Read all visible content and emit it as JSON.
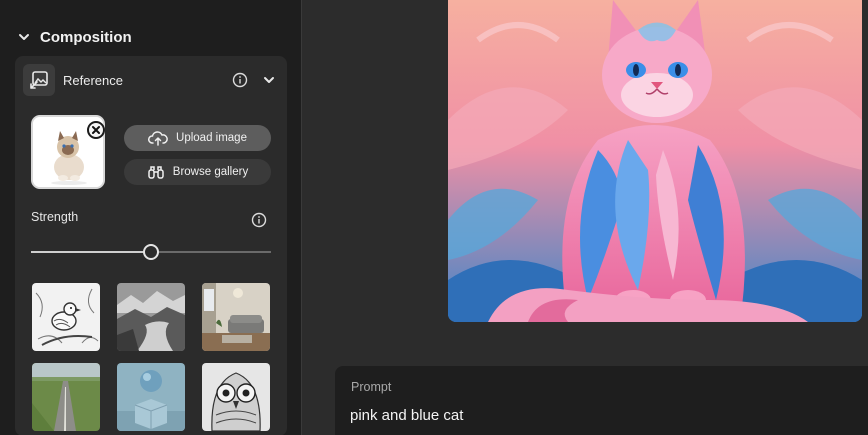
{
  "composition": {
    "title": "Composition",
    "reference": {
      "label": "Reference",
      "upload_label": "Upload image",
      "browse_label": "Browse gallery"
    },
    "strength": {
      "label": "Strength",
      "value_fraction": 0.5
    },
    "presets": [
      "bird-sketch",
      "misty-river",
      "living-room",
      "green-road",
      "sphere-on-cube",
      "owl-sketch"
    ]
  },
  "prompt": {
    "label": "Prompt",
    "value": "pink and blue cat"
  },
  "icons": {
    "section_toggle": "chevron-down-icon",
    "reference": "image-reference-icon",
    "info": "info-icon",
    "upload": "cloud-upload-icon",
    "browse": "binoculars-icon",
    "remove": "close-icon"
  },
  "colors": {
    "sidebar": "#1e1e1e",
    "panel": "#2b2b2b",
    "upload_button": "#5d5d5d",
    "browse_button": "#3a3a3a",
    "cat_pink": "#f07aa8",
    "cat_blue": "#4a8ee0"
  }
}
